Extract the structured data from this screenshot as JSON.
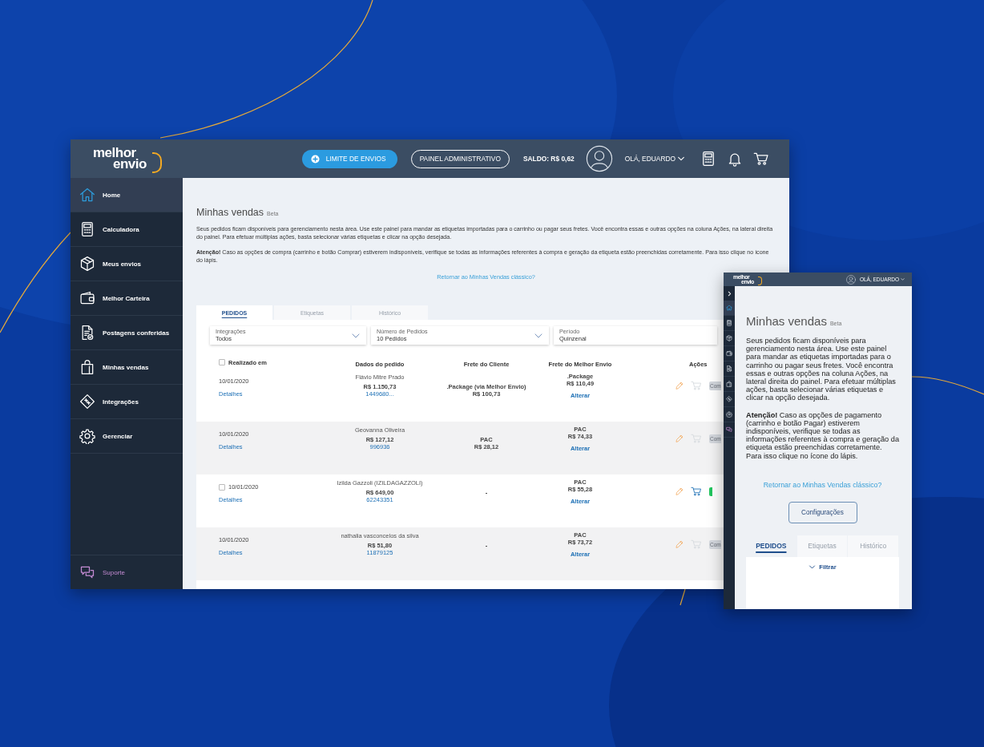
{
  "desktop": {
    "header": {
      "logo": [
        "melhor",
        "envio"
      ],
      "buttons": [
        {
          "label": "LIMITE DE ENVIOS",
          "kind": "primary"
        },
        {
          "label": "PAINEL ADMINISTRATIVO",
          "kind": "outline"
        }
      ],
      "balance": "SALDO: R$ 0,62",
      "greeting": "OLÁ, EDUARDO"
    },
    "sidebar": {
      "items": [
        {
          "label": "Home",
          "selected": true
        },
        {
          "label": "Calculadora",
          "selected": false
        },
        {
          "label": "Meus envios",
          "selected": false
        },
        {
          "label": "Melhor Carteira",
          "selected": false
        },
        {
          "label": "Postagens conferidas",
          "selected": false
        },
        {
          "label": "Minhas vendas",
          "selected": false
        },
        {
          "label": "Integrações",
          "selected": false
        },
        {
          "label": "Gerenciar",
          "selected": false
        }
      ],
      "support": "Suporte"
    },
    "content": {
      "title": "Minhas vendas",
      "badge": "Beta",
      "paragraphs": [
        "Seus pedidos ficam disponíveis para gerenciamento nesta área. Use este painel para mandar as etiquetas importadas para o carrinho ou pagar seus fretes. Você encontra essas e outras opções na coluna Ações, na lateral direita do painel. Para efetuar múltiplas ações, basta selecionar várias etiquetas e clicar na opção desejada.",
        "**Atenção!** Caso as opções de compra (carrinho e botão Comprar) estiverem indisponíveis, verifique se todas as informações referentes à compra e geração da etiqueta estão preenchidas corretamente. Para isso clique no ícone do lápis."
      ],
      "link": "Retornar ao Minhas Vendas clássico?",
      "tabs": [
        {
          "label": "PEDIDOS",
          "selected": true
        },
        {
          "label": "Etiquetas",
          "selected": false
        },
        {
          "label": "Histórico",
          "selected": false
        }
      ],
      "filters": [
        {
          "label": "Integrações",
          "value": "Todos",
          "kind": "select"
        },
        {
          "label": "Número de Pedidos",
          "value": "10 Pedidos",
          "kind": "select"
        },
        {
          "label": "Período",
          "value": "Quinzenal",
          "kind": "field"
        }
      ],
      "table": {
        "select_all": {
          "checked": false
        },
        "columns": [
          "Realizado em",
          "Dados do pedido",
          "Frete do Cliente",
          "Frete do Melhor Envio",
          "Ações"
        ],
        "rows": [
          {
            "date": "10/01/2020",
            "details": "Detalhes",
            "customer": "Flávio Mitre Prado",
            "total": "R$ 1.150,73",
            "order": "1449680...",
            "client_freight": [
              ".Package (via Melhor Envio)",
              "R$ 100,73"
            ],
            "service": ".Package",
            "price": "R$ 110,49",
            "change": "Alterar",
            "purchasable": false,
            "buy_button": "Com"
          },
          {
            "date": "10/01/2020",
            "details": "Detalhes",
            "customer": "Geovanna Oliveira",
            "total": "R$ 127,12",
            "order": "996936",
            "client_freight": [
              "PAC",
              "R$ 28,12"
            ],
            "service": "PAC",
            "price": "R$ 74,33",
            "change": "Alterar",
            "purchasable": false,
            "buy_button": "Com"
          },
          {
            "checkbox": {
              "checked": false
            },
            "date": "10/01/2020",
            "details": "Detalhes",
            "customer": "Izilda Gazzoli (IZILDAGAZZOLI)",
            "total": "R$ 649,00",
            "order": "62243351",
            "client_freight": [
              "-"
            ],
            "service": "PAC",
            "price": "R$ 55,28",
            "change": "Alterar",
            "purchasable": true
          },
          {
            "date": "10/01/2020",
            "details": "Detalhes",
            "customer": "nathalia vasconcelos da silva",
            "total": "R$ 51,80",
            "order": "11879125",
            "client_freight": [
              "-"
            ],
            "service": "PAC",
            "price": "R$ 73,72",
            "change": "Alterar",
            "purchasable": false,
            "buy_button": "Com"
          }
        ]
      }
    }
  },
  "mobile": {
    "header": {
      "logo": [
        "melhor",
        "envio"
      ],
      "greeting": "OLÁ, EDUARDO"
    },
    "nav": [
      {
        "selected": true
      },
      {
        "selected": false
      },
      {
        "selected": false
      },
      {
        "selected": false
      },
      {
        "selected": false
      },
      {
        "selected": false
      },
      {
        "selected": false
      },
      {
        "selected": false
      },
      {
        "selected": false
      }
    ],
    "content": {
      "title": "Minhas vendas",
      "badge": "Beta",
      "paragraphs": [
        "Seus pedidos ficam disponíveis para gerenciamento nesta área. Use este painel para mandar as etiquetas importadas para o carrinho ou pagar seus fretes. Você encontra essas e outras opções na coluna Ações, na lateral direita do painel. Para efetuar múltiplas ações, basta selecionar várias etiquetas e clicar na opção desejada.",
        "**Atenção!** Caso as opções de pagamento (carrinho e botão Pagar) estiverem indisponíveis, verifique se todas as informações referentes à compra e geração da etiqueta estão preenchidas corretamente. Para isso clique no ícone do lápis."
      ],
      "link": "Retornar ao Minhas Vendas clássico?",
      "button": "Configurações",
      "tabs": [
        {
          "label": "PEDIDOS",
          "selected": true
        },
        {
          "label": "Etiquetas",
          "selected": false
        },
        {
          "label": "Histórico",
          "selected": false
        }
      ],
      "filter": "Filtrar"
    }
  }
}
